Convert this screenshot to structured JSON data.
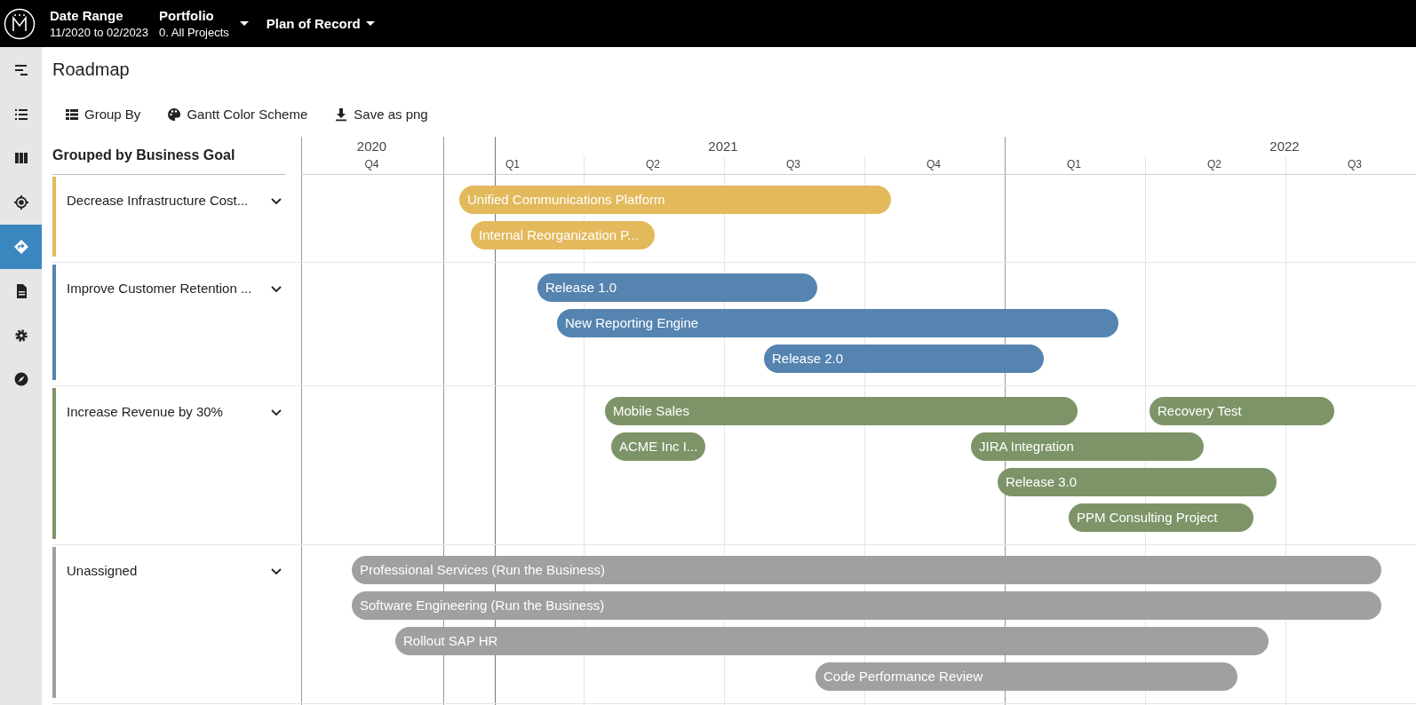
{
  "topbar": {
    "date_range": {
      "label": "Date Range",
      "value": "11/2020 to 02/2023"
    },
    "portfolio": {
      "label": "Portfolio",
      "value": "0. All Projects"
    },
    "plan": {
      "label": "Plan of Record"
    }
  },
  "sidebar": {
    "items": [
      {
        "selected": false
      },
      {
        "selected": false
      },
      {
        "selected": false
      },
      {
        "selected": false
      },
      {
        "selected": true
      },
      {
        "selected": false
      },
      {
        "selected": false
      },
      {
        "selected": false
      }
    ]
  },
  "page_title": "Roadmap",
  "toolbar": [
    "Group By",
    "Gantt Color Scheme",
    "Save as png"
  ],
  "grouping_label": "Grouped by Business Goal",
  "timeline": {
    "years": [
      {
        "label": "2020",
        "quarters": [
          "Q4"
        ]
      },
      {
        "label": "2021",
        "quarters": [
          "Q1",
          "Q2",
          "Q3",
          "Q4"
        ]
      },
      {
        "label": "2022",
        "quarters": [
          "Q1",
          "Q2",
          "Q3"
        ]
      }
    ]
  },
  "groups": [
    {
      "name": "Decrease Infrastructure Cost...",
      "color": "#e2b95b",
      "expanded": true,
      "rows": [
        {
          "bars": [
            "Unified Communications Platform"
          ]
        },
        {
          "bars": [
            "Internal Reorganization P..."
          ]
        }
      ]
    },
    {
      "name": "Improve Customer Retention ...",
      "color": "#5584b0",
      "expanded": true,
      "rows": [
        {
          "bars": [
            "Release 1.0"
          ]
        },
        {
          "bars": [
            "New Reporting Engine"
          ]
        },
        {
          "bars": [
            "Release 2.0"
          ]
        }
      ]
    },
    {
      "name": "Increase Revenue by 30%",
      "color": "#7d9468",
      "expanded": true,
      "rows": [
        {
          "bars": [
            "Mobile Sales",
            "Recovery Test"
          ]
        },
        {
          "bars": [
            "ACME Inc I...",
            "JIRA Integration"
          ]
        },
        {
          "bars": [
            "Release 3.0"
          ]
        },
        {
          "bars": [
            "PPM Consulting Project"
          ]
        }
      ]
    },
    {
      "name": "Unassigned",
      "color": "#a0a0a0",
      "expanded": true,
      "rows": [
        {
          "bars": [
            "Professional Services (Run the Business)"
          ]
        },
        {
          "bars": [
            "Software Engineering (Run the Business)"
          ]
        },
        {
          "bars": [
            "Rollout SAP HR"
          ]
        },
        {
          "bars": [
            "Code Performance Review"
          ]
        }
      ]
    }
  ]
}
